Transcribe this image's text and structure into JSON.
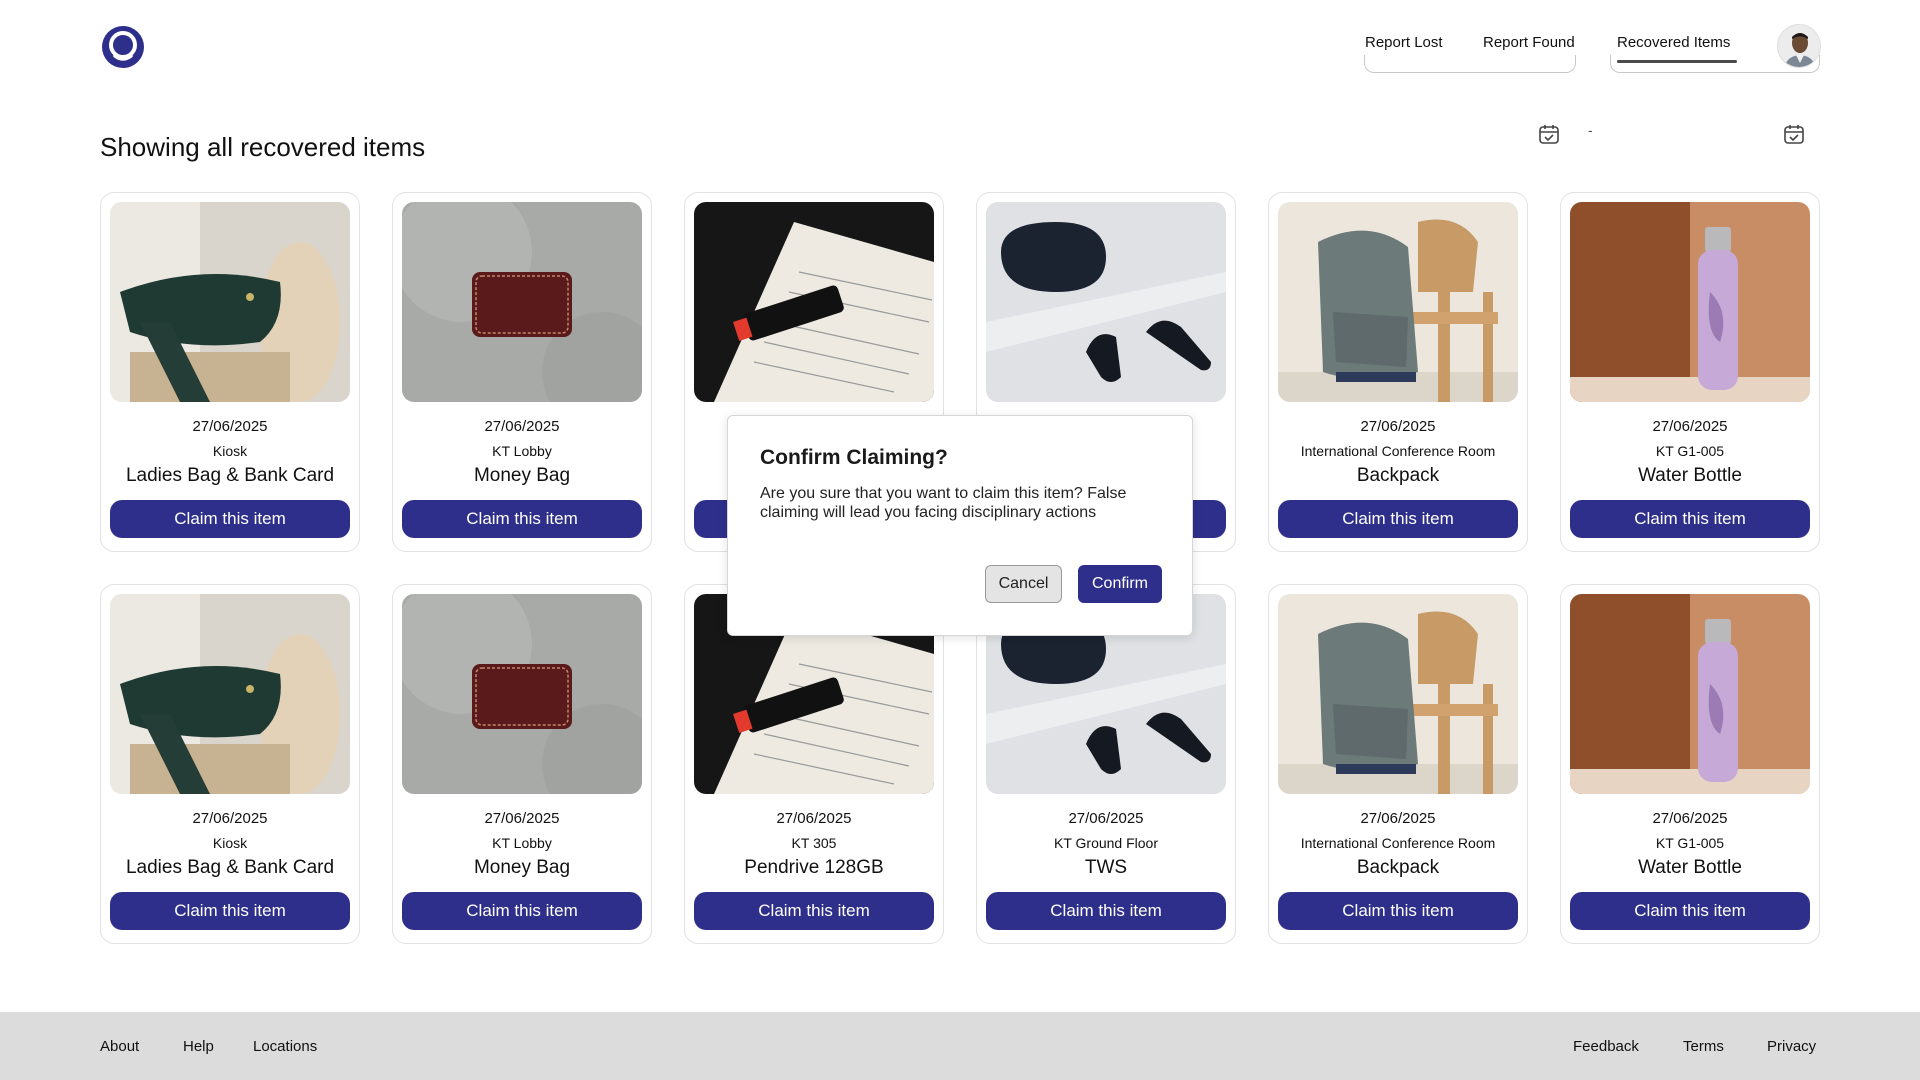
{
  "header": {
    "nav": {
      "report_lost": "Report Lost",
      "report_found": "Report Found",
      "recovered_items": "Recovered Items"
    },
    "active_tab": "Recovered Items"
  },
  "page": {
    "title": "Showing all recovered items",
    "date_separator": "-"
  },
  "items": [
    {
      "date": "27/06/2025",
      "location": "Kiosk",
      "name": "Ladies Bag & Bank Card",
      "claim_label": "Claim this item",
      "image": "bag"
    },
    {
      "date": "27/06/2025",
      "location": "KT Lobby",
      "name": "Money Bag",
      "claim_label": "Claim this item",
      "image": "wallet"
    },
    {
      "date": "",
      "location": "",
      "name": "",
      "claim_label": "",
      "image": "pendrive"
    },
    {
      "date": "",
      "location": "",
      "name": "",
      "claim_label": "",
      "image": "earbuds"
    },
    {
      "date": "27/06/2025",
      "location": "International Conference Room",
      "name": "Backpack",
      "claim_label": "Claim this item",
      "image": "backpack"
    },
    {
      "date": "27/06/2025",
      "location": "KT G1-005",
      "name": "Water Bottle",
      "claim_label": "Claim this item",
      "image": "bottle"
    },
    {
      "date": "27/06/2025",
      "location": "Kiosk",
      "name": "Ladies Bag & Bank Card",
      "claim_label": "Claim this item",
      "image": "bag"
    },
    {
      "date": "27/06/2025",
      "location": "KT Lobby",
      "name": "Money Bag",
      "claim_label": "Claim this item",
      "image": "wallet"
    },
    {
      "date": "27/06/2025",
      "location": "KT 305",
      "name": "Pendrive 128GB",
      "claim_label": "Claim this item",
      "image": "pendrive"
    },
    {
      "date": "27/06/2025",
      "location": "KT Ground Floor",
      "name": "TWS",
      "claim_label": "Claim this item",
      "image": "earbuds"
    },
    {
      "date": "27/06/2025",
      "location": "International Conference Room",
      "name": "Backpack",
      "claim_label": "Claim this item",
      "image": "backpack"
    },
    {
      "date": "27/06/2025",
      "location": "KT G1-005",
      "name": "Water Bottle",
      "claim_label": "Claim this item",
      "image": "bottle"
    }
  ],
  "modal": {
    "title": "Confirm Claiming?",
    "body": "Are you sure that you want to claim this item? False claiming will lead you facing disciplinary actions",
    "cancel_label": "Cancel",
    "confirm_label": "Confirm"
  },
  "footer": {
    "about": "About",
    "help": "Help",
    "locations": "Locations",
    "feedback": "Feedback",
    "terms": "Terms",
    "privacy": "Privacy"
  },
  "colors": {
    "primary": "#2e2f8a",
    "footer_bg": "#dcdcdc",
    "card_border": "#e2e2e2"
  }
}
